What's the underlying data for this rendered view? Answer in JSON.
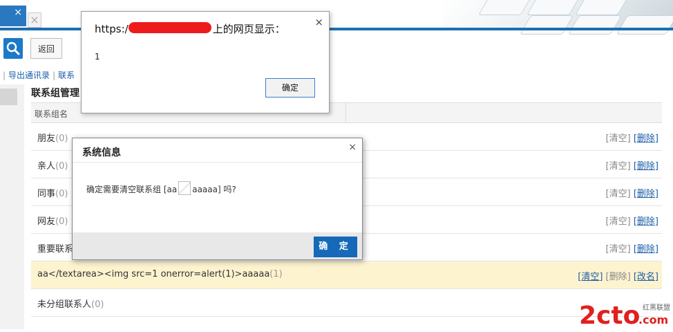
{
  "tabs": {
    "active_close": "×",
    "new_tab": "×"
  },
  "toolbar": {
    "back_label": "返回"
  },
  "linkbar": {
    "items": [
      "导出通讯录",
      "联系"
    ]
  },
  "section": {
    "title": "联系组管理",
    "column_name": "联系组名"
  },
  "rows": [
    {
      "name": "朋友",
      "count": "(0)",
      "actions": [
        "[清空]",
        "[删除]"
      ]
    },
    {
      "name": "亲人",
      "count": "(0)",
      "actions": [
        "[清空]",
        "[删除]"
      ]
    },
    {
      "name": "同事",
      "count": "(0)",
      "actions": [
        "[清空]",
        "[删除]"
      ]
    },
    {
      "name": "网友",
      "count": "(0)",
      "actions": [
        "[清空]",
        "[删除]"
      ]
    },
    {
      "name": "重要联系",
      "count": "",
      "actions": [
        "[清空]",
        "[删除]"
      ]
    },
    {
      "name": "aa</textarea><img src=1 onerror=alert(1)>aaaaa",
      "count": "(1)",
      "actions": [
        "[清空]",
        "[删除]",
        "[改名]"
      ]
    },
    {
      "name": "未分组联系人",
      "count": "(0)",
      "actions": []
    }
  ],
  "alert": {
    "prefix": "https:/",
    "suffix": "上的网页显示：",
    "message": "1",
    "ok_label": "确定",
    "close": "×"
  },
  "system_dialog": {
    "title": "系统信息",
    "close": "×",
    "message_prefix": "确定需要清空联系组 [aa",
    "message_suffix": "aaaaa] 吗?",
    "ok_label": "确 定"
  },
  "watermark": {
    "text": "2cto",
    "tld": ".com",
    "cn": "红黑联盟"
  },
  "colors": {
    "accent": "#1b6fb3",
    "link": "#1a5da8",
    "highlight_row": "#fdf3cf",
    "redaction": "#ee1b1b",
    "watermark": "#e02020"
  }
}
